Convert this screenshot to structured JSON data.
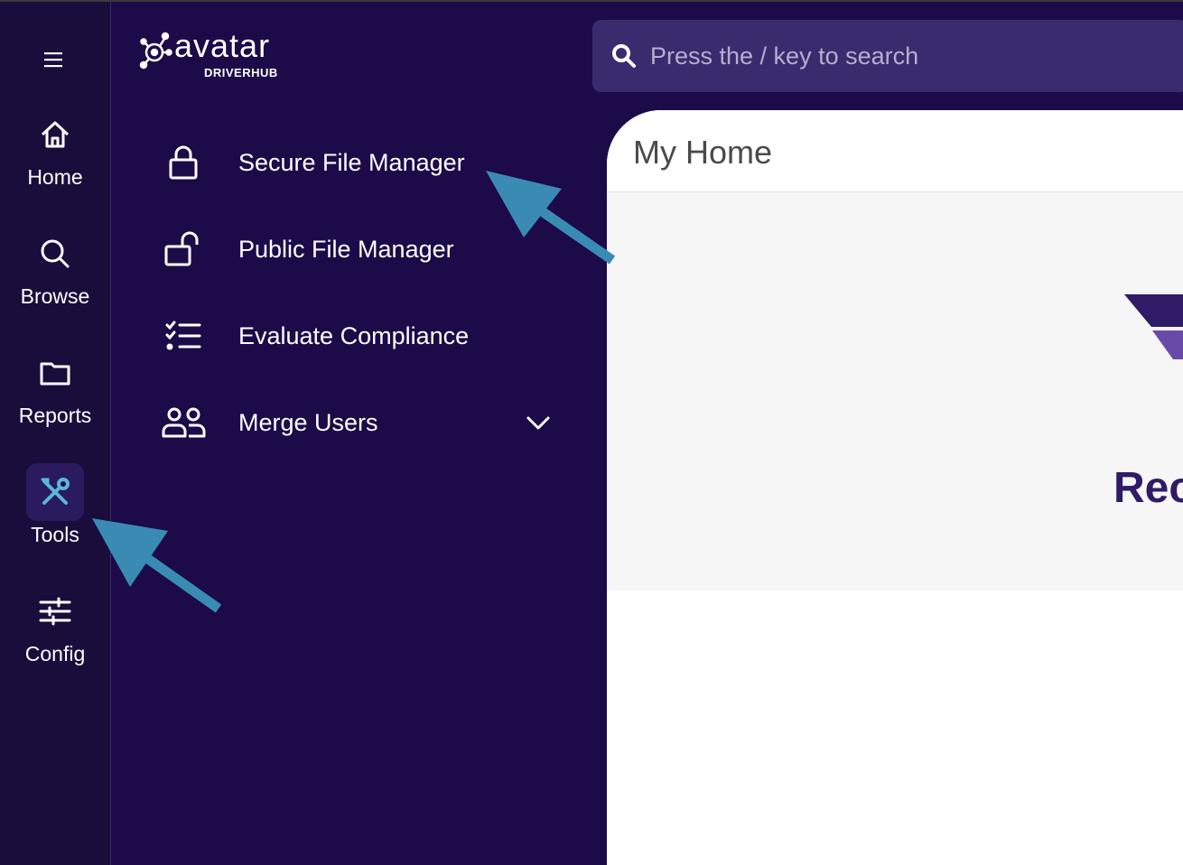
{
  "rail": {
    "menu_icon": "hamburger-icon",
    "items": [
      {
        "label": "Home",
        "icon": "home-icon"
      },
      {
        "label": "Browse",
        "icon": "search-icon"
      },
      {
        "label": "Reports",
        "icon": "folder-icon"
      },
      {
        "label": "Tools",
        "icon": "tools-icon",
        "active": true
      },
      {
        "label": "Config",
        "icon": "sliders-icon"
      }
    ]
  },
  "logo": {
    "word": "avatar",
    "sub": "DRIVERHUB"
  },
  "submenu": {
    "items": [
      {
        "label": "Secure File Manager",
        "icon": "lock-icon"
      },
      {
        "label": "Public File Manager",
        "icon": "unlock-icon"
      },
      {
        "label": "Evaluate Compliance",
        "icon": "checklist-icon"
      },
      {
        "label": "Merge Users",
        "icon": "users-icon",
        "expandable": true
      }
    ]
  },
  "search": {
    "placeholder": "Press the / key to search"
  },
  "content": {
    "title": "My Home",
    "partial_heading": "Rec"
  },
  "colors": {
    "sidebar": "#1c0b48",
    "rail": "#1a0d3c",
    "search_bg": "#3a2b6e",
    "accent_arrow": "#3a8bb4",
    "brand_purple": "#2f1b66"
  }
}
